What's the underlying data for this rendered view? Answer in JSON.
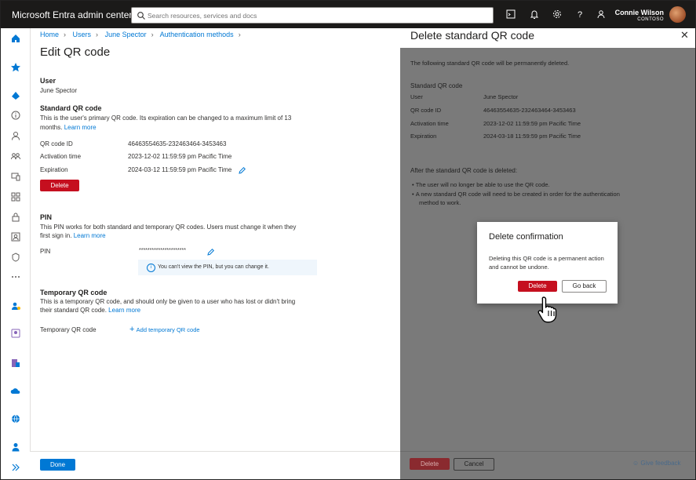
{
  "app": {
    "title": "Microsoft Entra admin center"
  },
  "search": {
    "placeholder": "Search resources, services and docs"
  },
  "user": {
    "name": "Connie Wilson",
    "org": "CONTOSO"
  },
  "breadcrumb": [
    "Home",
    "Users",
    "June Spector",
    "Authentication methods"
  ],
  "page": {
    "title": "Edit QR code"
  },
  "user_section": {
    "title": "User",
    "value": "June Spector"
  },
  "standard": {
    "title": "Standard QR code",
    "desc1": "This is the user's primary QR code. Its expiration can be changed to a maximum limit of 13",
    "desc2": "months.",
    "learn_more": "Learn more",
    "rows": [
      {
        "label": "QR code ID",
        "value": "46463554635-232463464-3453463"
      },
      {
        "label": "Activation time",
        "value": "2023-12-02 11:59:59 pm Pacific Time"
      },
      {
        "label": "Expiration",
        "value": "2024-03-12 11:59:59 pm Pacific Time"
      }
    ],
    "delete_label": "Delete"
  },
  "pin": {
    "title": "PIN",
    "desc1": "This PIN works for both standard and temporary QR codes. Users must change it when they",
    "desc2": "first sign in.",
    "learn_more": "Learn more",
    "label": "PIN",
    "value": "**********************",
    "info": "You can't view the PIN, but you can change it."
  },
  "temp": {
    "title": "Temporary QR code",
    "desc1": "This is a temporary QR code, and should only be given to a user who has lost or didn't bring",
    "desc2": "their standard QR code.",
    "learn_more": "Learn more",
    "label": "Temporary QR code",
    "add_label": "Add temporary QR code"
  },
  "footer": {
    "done_label": "Done"
  },
  "panel": {
    "title": "Delete standard QR code",
    "intro": "The following standard QR code will be permanently deleted.",
    "section": "Standard QR code",
    "rows": [
      {
        "label": "User",
        "value": "June Spector"
      },
      {
        "label": "QR code ID",
        "value": "46463554635-232463464-3453463"
      },
      {
        "label": "Activation time",
        "value": "2023-12-02 11:59:59 pm Pacific Time"
      },
      {
        "label": "Expiration",
        "value": "2024-03-18 11:59:59 pm Pacific Time"
      }
    ],
    "after_title": "After the standard QR code is deleted:",
    "bullets": [
      "The user will no longer be able to use the QR code.",
      "A new standard QR code will need to be created in order for the authentication",
      "method to work."
    ],
    "delete_label": "Delete",
    "cancel_label": "Cancel",
    "feedback_label": "Give feedback"
  },
  "dialog": {
    "title": "Delete confirmation",
    "message": "Deleting this QR code is a permanent action and cannot be undone.",
    "delete_label": "Delete",
    "goback_label": "Go back"
  },
  "colors": {
    "accent": "#0078d4",
    "danger": "#c50f1f",
    "topbar": "#1b1a19"
  }
}
